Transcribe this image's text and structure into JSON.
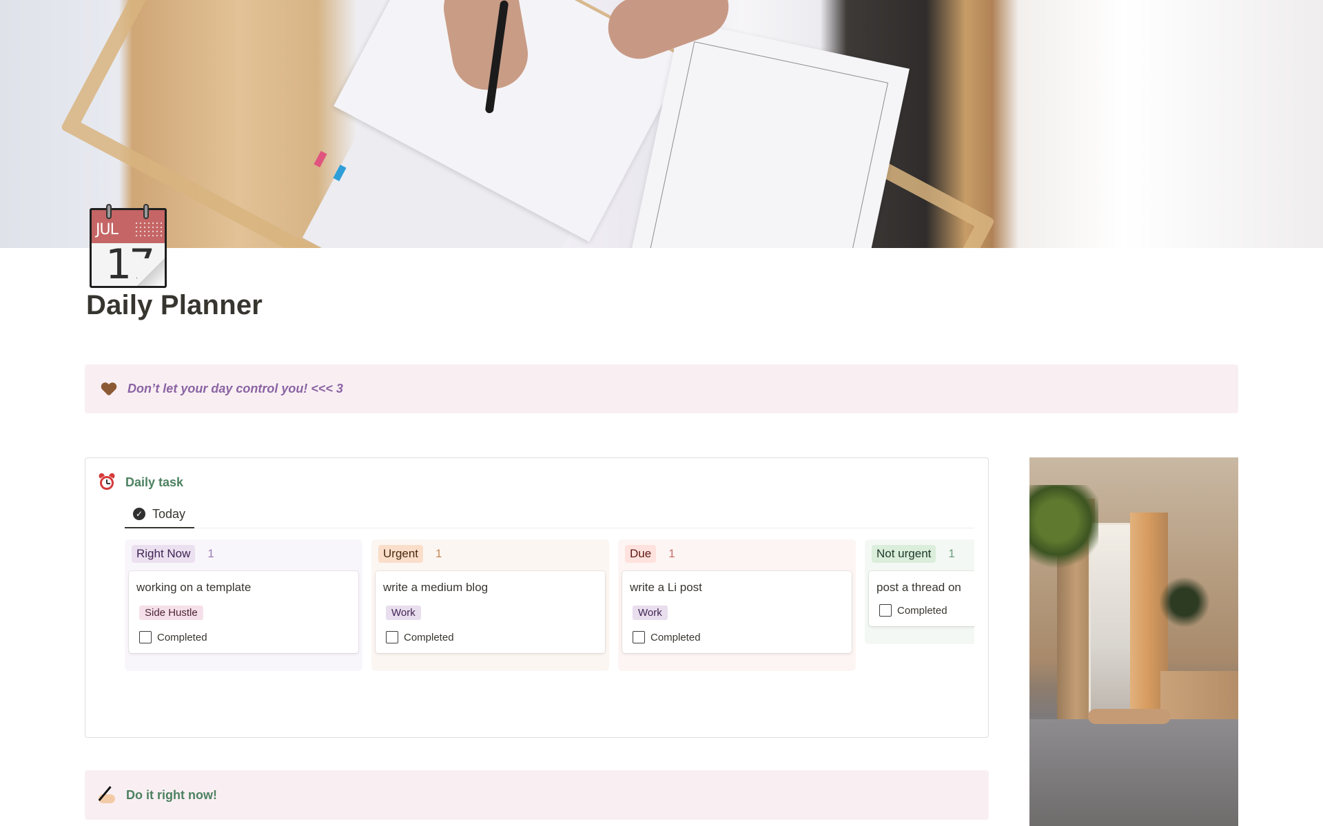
{
  "cover": {
    "description": "Cover photo: hands writing on planner pages on a wooden tray in bed"
  },
  "page": {
    "icon": {
      "month": "JUL",
      "day": "17",
      "name": "calendar-icon"
    },
    "title": "Daily Planner"
  },
  "quote_callout": {
    "icon": "brown-heart-icon",
    "text": "Don’t let your day control you! <<< 3",
    "text_color": "#8b63a3",
    "background": "#f9eff3"
  },
  "database": {
    "icon": "alarm-clock-icon",
    "title": "Daily task",
    "title_color": "#4c8160",
    "views": [
      {
        "label": "Today",
        "icon": "check-circle-icon",
        "active": true
      }
    ],
    "columns": [
      {
        "label": "Right Now",
        "count": "1",
        "pill_bg": "#ebe0f0",
        "pill_text": "#412454",
        "count_color": "#9b7bb5",
        "col_bg": "#f9f6fb",
        "cards": [
          {
            "title": "working on a template",
            "tag": "Side Hustle",
            "tag_bg": "#f5e0e9",
            "tag_text": "#4c2337",
            "checkbox_label": "Completed",
            "checked": false
          }
        ]
      },
      {
        "label": "Urgent",
        "count": "1",
        "pill_bg": "#fadec9",
        "pill_text": "#49290e",
        "count_color": "#c58a56",
        "col_bg": "#fcf6f3",
        "cards": [
          {
            "title": "write a medium blog",
            "tag": "Work",
            "tag_bg": "#e8deee",
            "tag_text": "#412454",
            "checkbox_label": "Completed",
            "checked": false
          }
        ]
      },
      {
        "label": "Due",
        "count": "1",
        "pill_bg": "#ffe2dd",
        "pill_text": "#5d1715",
        "count_color": "#c4706a",
        "col_bg": "#fdf5f3",
        "cards": [
          {
            "title": "write a Li post",
            "tag": "Work",
            "tag_bg": "#e8deee",
            "tag_text": "#412454",
            "checkbox_label": "Completed",
            "checked": false
          }
        ]
      },
      {
        "label": "Not urgent",
        "count": "1",
        "pill_bg": "#dbeddb",
        "pill_text": "#1c3829",
        "count_color": "#6c9b7d",
        "col_bg": "#f4f8f4",
        "cards": [
          {
            "title": "post a thread on",
            "tag": "",
            "checkbox_label": "Completed",
            "checked": false
          }
        ]
      }
    ]
  },
  "action_callout": {
    "icon": "writing-hand-icon",
    "text": "Do it right now!",
    "text_color": "#4c8160"
  },
  "side_photo": {
    "description": "Cozy sunlit bedroom with plants and a cat on the bed"
  }
}
